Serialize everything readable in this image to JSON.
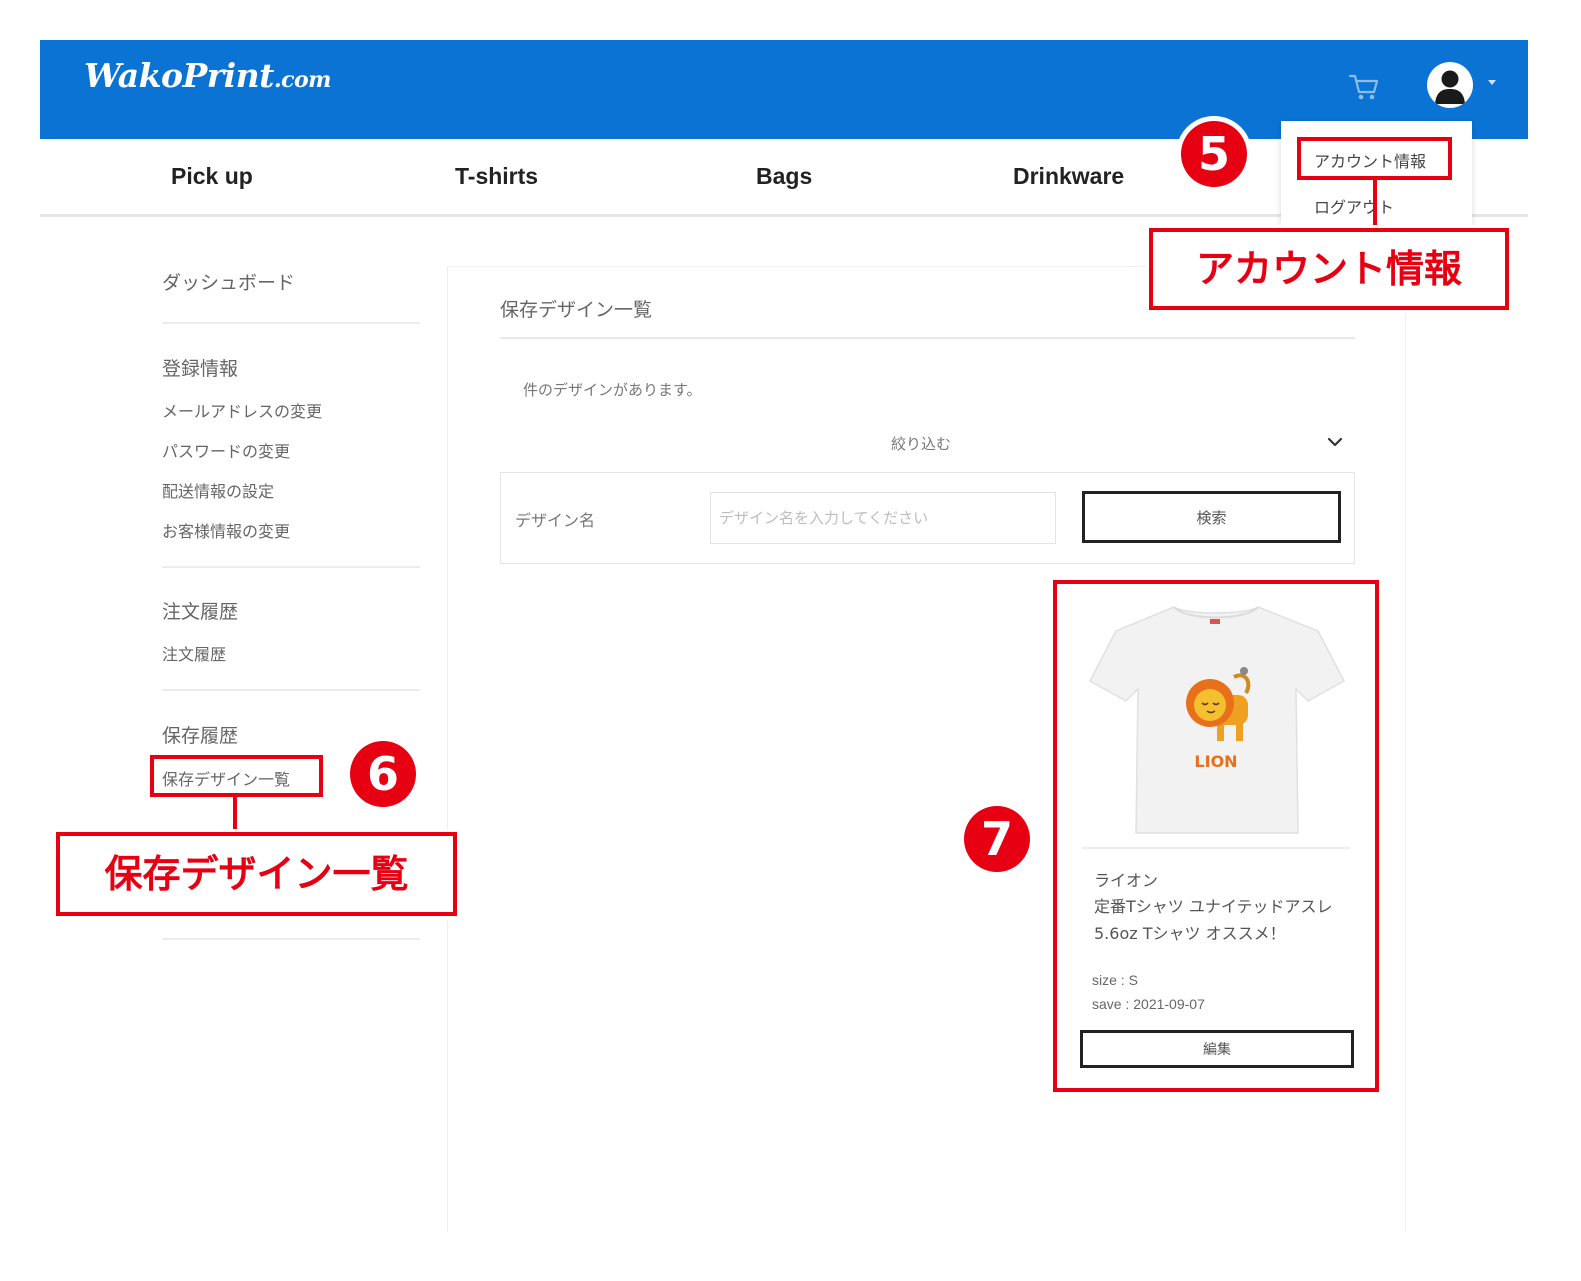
{
  "header": {
    "logo": "WakoPrint",
    "logo_suffix": ".com",
    "cart_icon": "cart-icon",
    "account_icon": "user-avatar-icon",
    "brand_color": "#0b73d4"
  },
  "nav": {
    "items": [
      {
        "label": "Pick up"
      },
      {
        "label": "T-shirts"
      },
      {
        "label": "Bags"
      },
      {
        "label": "Drinkware"
      }
    ]
  },
  "account_menu": {
    "items": [
      {
        "label": "アカウント情報"
      },
      {
        "label": "ログアウト"
      }
    ]
  },
  "sidebar": {
    "dashboard": "ダッシュボード",
    "registration": {
      "title": "登録情報",
      "links": [
        "メールアドレスの変更",
        "パスワードの変更",
        "配送情報の設定",
        "お客様情報の変更"
      ]
    },
    "orders": {
      "title": "注文履歴",
      "links": [
        "注文履歴"
      ]
    },
    "saved": {
      "title": "保存履歴",
      "links": [
        "保存デザイン一覧"
      ]
    }
  },
  "main": {
    "title": "保存デザイン一覧",
    "count_text": "件のデザインがあります。",
    "filter_toggle": "絞り込む",
    "filter": {
      "label": "デザイン名",
      "placeholder": "デザイン名を入力してください",
      "value": "",
      "search_button": "検索"
    },
    "designs": [
      {
        "name": "ライオン",
        "product": "定番Tシャツ ユナイテッドアスレ 5.6oz Tシャツ オススメ！",
        "size": "size : S",
        "save": "save : 2021-09-07",
        "edit_button": "編集",
        "print_text": "LION"
      }
    ]
  },
  "annotations": {
    "accent_color": "#e60012",
    "steps": [
      {
        "number": "5",
        "callout": "アカウント情報"
      },
      {
        "number": "6",
        "callout": "保存デザイン一覧"
      },
      {
        "number": "7"
      }
    ]
  }
}
